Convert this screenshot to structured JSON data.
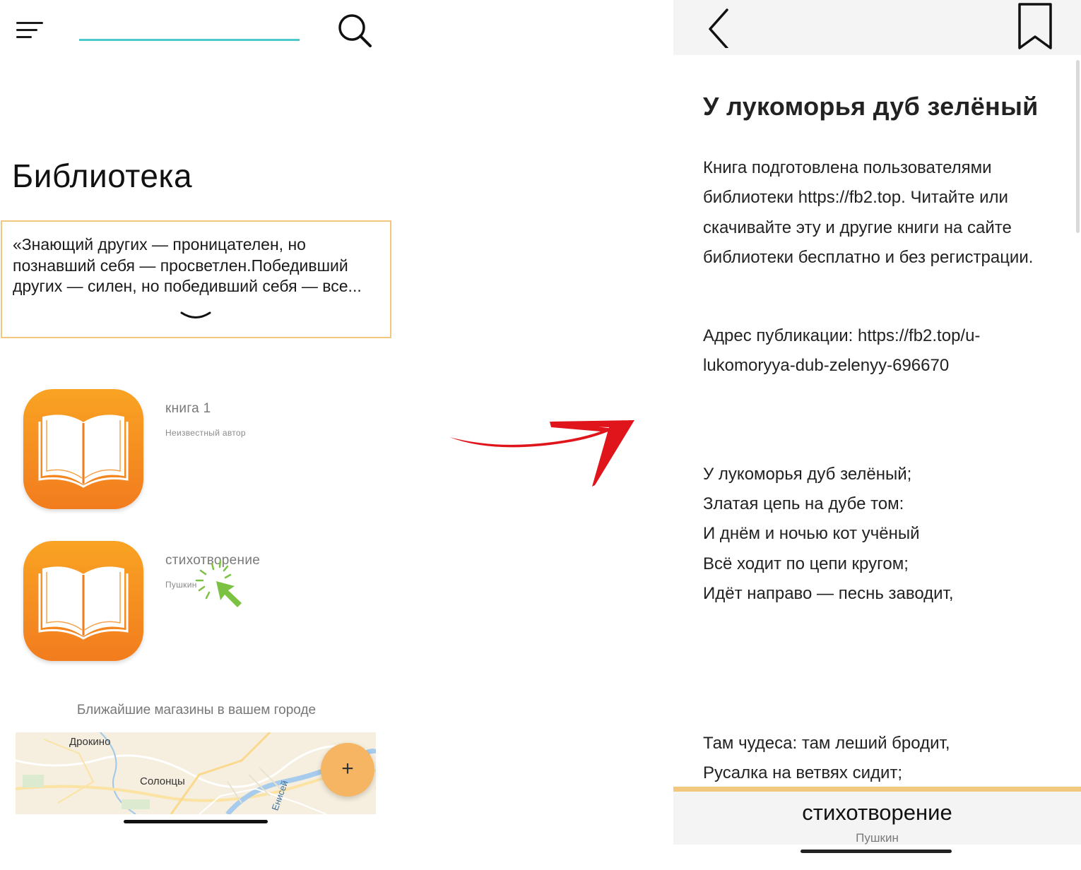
{
  "library_screen": {
    "title": "Библиотека",
    "quote": "«Знающий других — проницателен, но познавший себя — просветлен.Победивший других — силен, но победивший себя — все...",
    "books": [
      {
        "title": "книга 1",
        "author": "Неизвестный автор"
      },
      {
        "title": "стихотворение",
        "author": "Пушкин"
      }
    ],
    "shops_label": "Ближайшие магазины в вашем городе",
    "map_labels": [
      "Дрокино",
      "Солонцы",
      "Енисей"
    ],
    "fab_label": "+"
  },
  "reader_screen": {
    "title": "У лукоморья дуб зелёный",
    "intro": "Книга подготовлена пользователями библиотеки https://fb2.top. Читайте или скачивайте эту и другие книги на сайте библиотеки бесплатно и без регистрации.",
    "address": "Адрес публикации: https://fb2.top/u-lukomoryya-dub-zelenyy-696670",
    "verse_lines": [
      "У лукоморья дуб зелёный;",
      "Златая цепь на дубе том:",
      "И днём и ночью кот учёный",
      "Всё ходит по цепи кругом;",
      "Идёт направо — песнь заводит,"
    ],
    "verse_lines_2": [
      "Там чудеса: там леший бродит,",
      "Русалка на ветвях сидит;"
    ],
    "bottom_title": "стихотворение",
    "bottom_author": "Пушкин"
  },
  "colors": {
    "accent_orange": "#f27c1e",
    "accent_gold": "#f2c87e",
    "search_underline": "#4cc7cc",
    "arrow_red": "#e0151b",
    "cursor_green": "#7cc242"
  },
  "icons": [
    "menu-icon",
    "search-icon",
    "chevron-down-icon",
    "book-icon",
    "pointer-icon",
    "back-icon",
    "bookmark-icon",
    "plus-icon"
  ]
}
